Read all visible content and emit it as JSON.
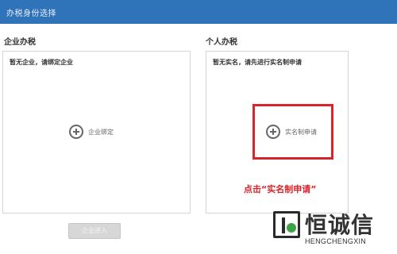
{
  "window": {
    "title": "办税身份选择"
  },
  "enterprise": {
    "section_title": "企业办税",
    "hint": "暂无企业，请绑定企业",
    "action_label": "企业绑定",
    "button_label": "企业进入"
  },
  "personal": {
    "section_title": "个人办税",
    "hint": "暂无实名，请先进行实名制申请",
    "action_label": "实名制申请",
    "annotation": "点击“实名制申请”",
    "highlight_color": "#d9252a"
  },
  "watermark": {
    "brand": "恒诚信",
    "subtitle": "HENGCHENGXIN"
  },
  "colors": {
    "titlebar": "#2f73b8",
    "accent_red": "#d9252a"
  }
}
